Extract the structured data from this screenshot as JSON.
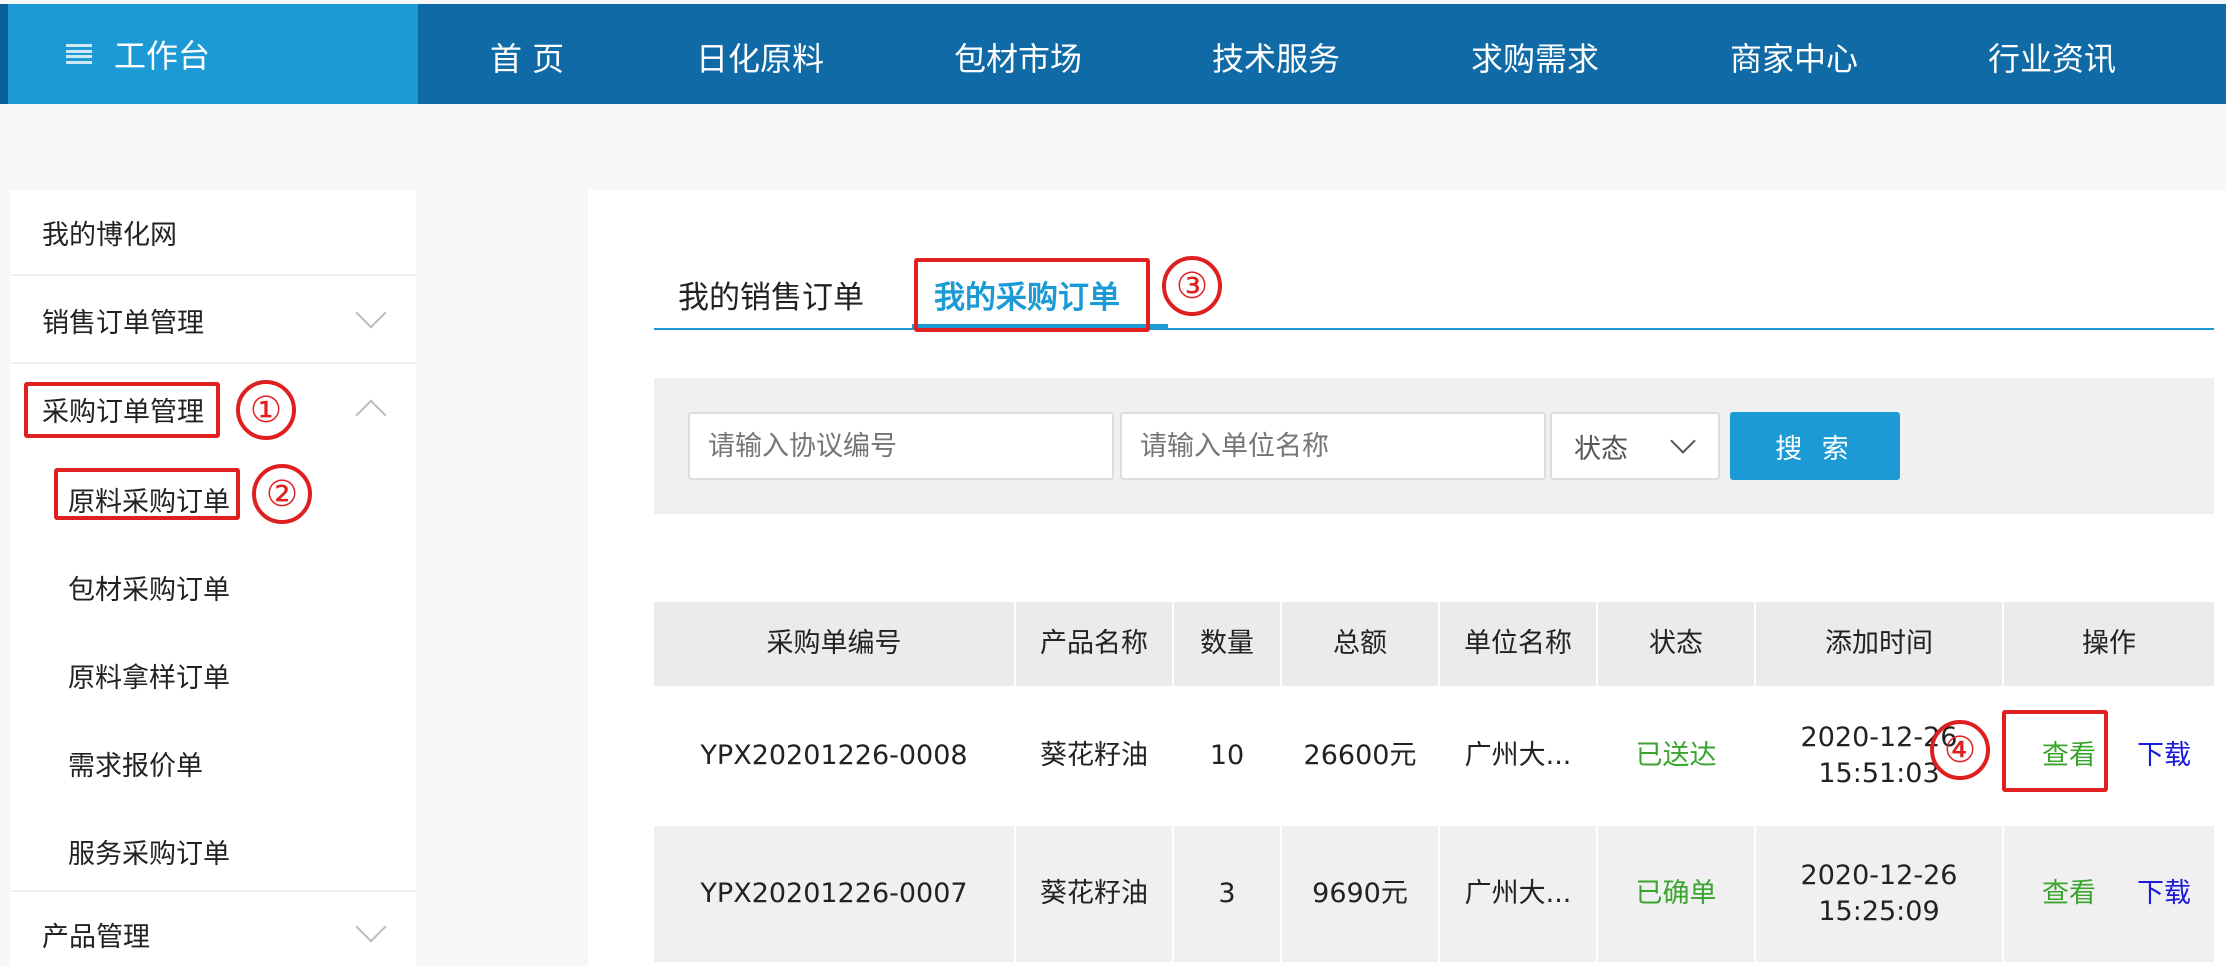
{
  "header": {
    "brand": "工作台",
    "nav": [
      "首 页",
      "日化原料",
      "包材市场",
      "技术服务",
      "求购需求",
      "商家中心",
      "行业资讯"
    ]
  },
  "sidebar": {
    "home": "我的博化网",
    "sales": "销售订单管理",
    "purchase": "采购订单管理",
    "purchase_items": [
      "原料采购订单",
      "包材采购订单",
      "原料拿样订单",
      "需求报价单",
      "服务采购订单"
    ],
    "product": "产品管理"
  },
  "annotations": [
    "①",
    "②",
    "③",
    "④"
  ],
  "tabs": [
    "我的销售订单",
    "我的采购订单"
  ],
  "search": {
    "agreement_placeholder": "请输入协议编号",
    "unit_placeholder": "请输入单位名称",
    "status_label": "状态",
    "button": "搜 索"
  },
  "table": {
    "columns": [
      "采购单编号",
      "产品名称",
      "数量",
      "总额",
      "单位名称",
      "状态",
      "添加时间",
      "操作"
    ],
    "rows": [
      {
        "id": "YPX20201226-0008",
        "product": "葵花籽油",
        "qty": "10",
        "total": "26600元",
        "unit": "广州大...",
        "status": "已送达",
        "date": "2020-12-26",
        "time": "15:51:03",
        "view": "查看",
        "download": "下载"
      },
      {
        "id": "YPX20201226-0007",
        "product": "葵花籽油",
        "qty": "3",
        "total": "9690元",
        "unit": "广州大...",
        "status": "已确单",
        "date": "2020-12-26",
        "time": "15:25:09",
        "view": "查看",
        "download": "下载"
      }
    ]
  },
  "colors": {
    "nav_bg": "#0f6aa5",
    "brand_bg": "#1b9ad6",
    "accent": "#1b9ad6",
    "status_green": "#3aa52e",
    "link_blue": "#1a1adc",
    "annotation_red": "#e02020"
  }
}
